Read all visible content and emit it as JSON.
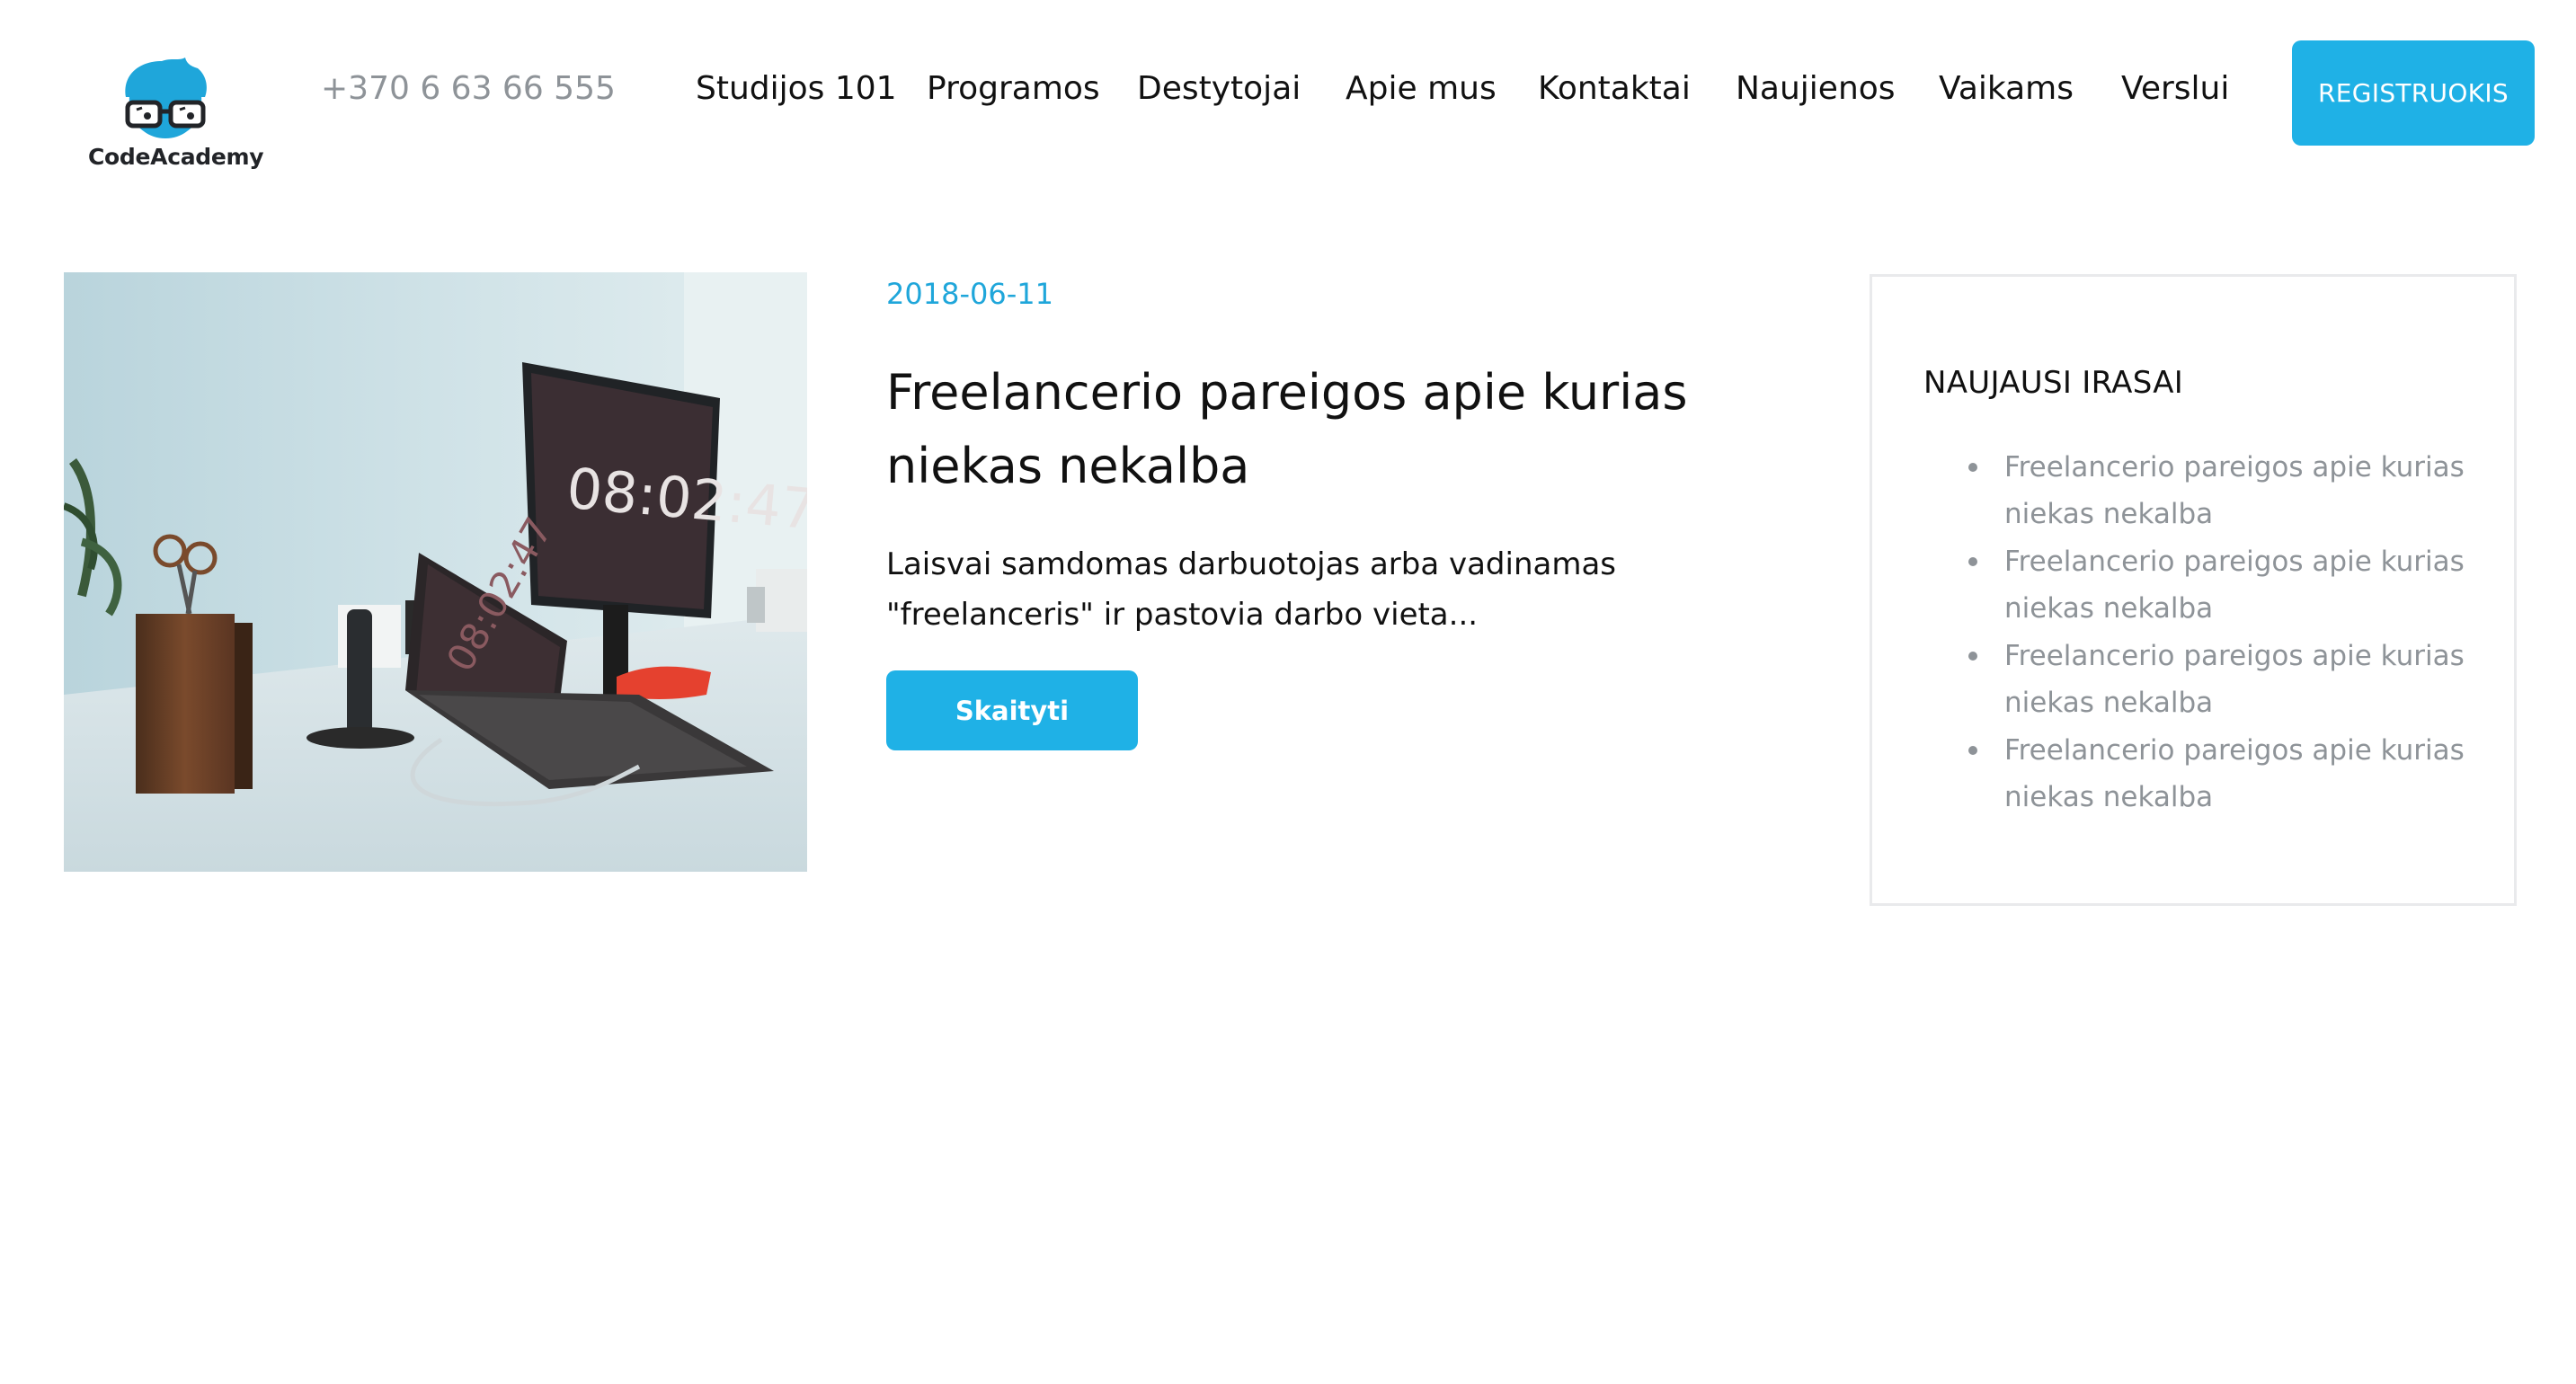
{
  "header": {
    "logo_text": "CodeAcademy",
    "phone": "+370 6 63 66 555",
    "nav": [
      {
        "label": "Studijos 101"
      },
      {
        "label": "Programos"
      },
      {
        "label": "Destytojai"
      },
      {
        "label": "Apie mus"
      },
      {
        "label": "Kontaktai"
      },
      {
        "label": "Naujienos"
      },
      {
        "label": "Vaikams"
      },
      {
        "label": "Verslui"
      }
    ],
    "register_label": "REGISTRUOKIS"
  },
  "post": {
    "date": "2018-06-11",
    "title": "Freelancerio pareigos apie kurias niekas nekalba",
    "excerpt": "Laisvai samdomas darbuotojas arba vadinamas \"freelanceris\" ir pastovia darbo vieta...",
    "read_label": "Skaityti",
    "image_clock": "08:02:47"
  },
  "sidebar": {
    "title": "NAUJAUSI IRASAI",
    "items": [
      {
        "label": "Freelancerio pareigos apie kurias niekas nekalba"
      },
      {
        "label": "Freelancerio pareigos apie kurias niekas nekalba"
      },
      {
        "label": "Freelancerio pareigos apie kurias niekas nekalba"
      },
      {
        "label": "Freelancerio pareigos apie kurias niekas nekalba"
      }
    ]
  },
  "colors": {
    "accent": "#1fb1e6",
    "date": "#1fa6da",
    "muted": "#8e9398",
    "text": "#111111"
  }
}
